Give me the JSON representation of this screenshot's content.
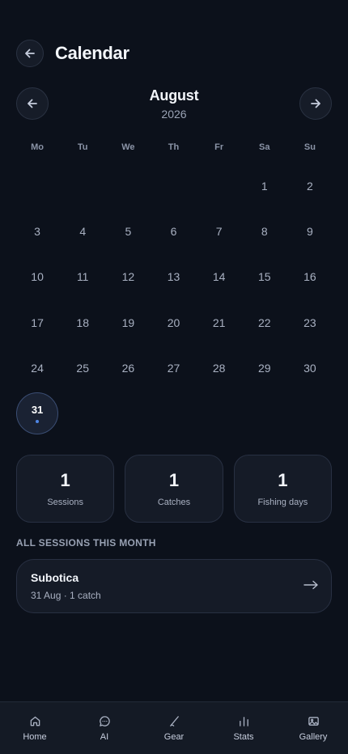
{
  "header": {
    "title": "Calendar",
    "back_icon": "arrow-left-icon"
  },
  "month_nav": {
    "month": "August",
    "year": "2026",
    "prev_icon": "arrow-left-icon",
    "next_icon": "arrow-right-icon"
  },
  "weekdays": [
    "Mo",
    "Tu",
    "We",
    "Th",
    "Fr",
    "Sa",
    "Su"
  ],
  "calendar": {
    "leading_blanks": 5,
    "days": [
      "1",
      "2",
      "3",
      "4",
      "5",
      "6",
      "7",
      "8",
      "9",
      "10",
      "11",
      "12",
      "13",
      "14",
      "15",
      "16",
      "17",
      "18",
      "19",
      "20",
      "21",
      "22",
      "23",
      "24",
      "25",
      "26",
      "27",
      "28",
      "29",
      "30",
      "31"
    ],
    "selected_day": "31",
    "days_with_sessions": [
      "31"
    ]
  },
  "stats": [
    {
      "value": "1",
      "label": "Sessions"
    },
    {
      "value": "1",
      "label": "Catches"
    },
    {
      "value": "1",
      "label": "Fishing days"
    }
  ],
  "sessions_section": {
    "title": "ALL SESSIONS THIS MONTH",
    "items": [
      {
        "name": "Subotica",
        "meta": "31 Aug · 1 catch"
      }
    ]
  },
  "bottom_nav": [
    {
      "label": "Home",
      "icon": "home-icon"
    },
    {
      "label": "AI",
      "icon": "chat-icon"
    },
    {
      "label": "Gear",
      "icon": "fishing-rod-icon"
    },
    {
      "label": "Stats",
      "icon": "bar-chart-icon"
    },
    {
      "label": "Gallery",
      "icon": "image-icon"
    }
  ],
  "colors": {
    "background": "#0c111b",
    "card": "#151b27",
    "accent_dot": "#4f86e6",
    "today_ring": "#3b4e74"
  }
}
